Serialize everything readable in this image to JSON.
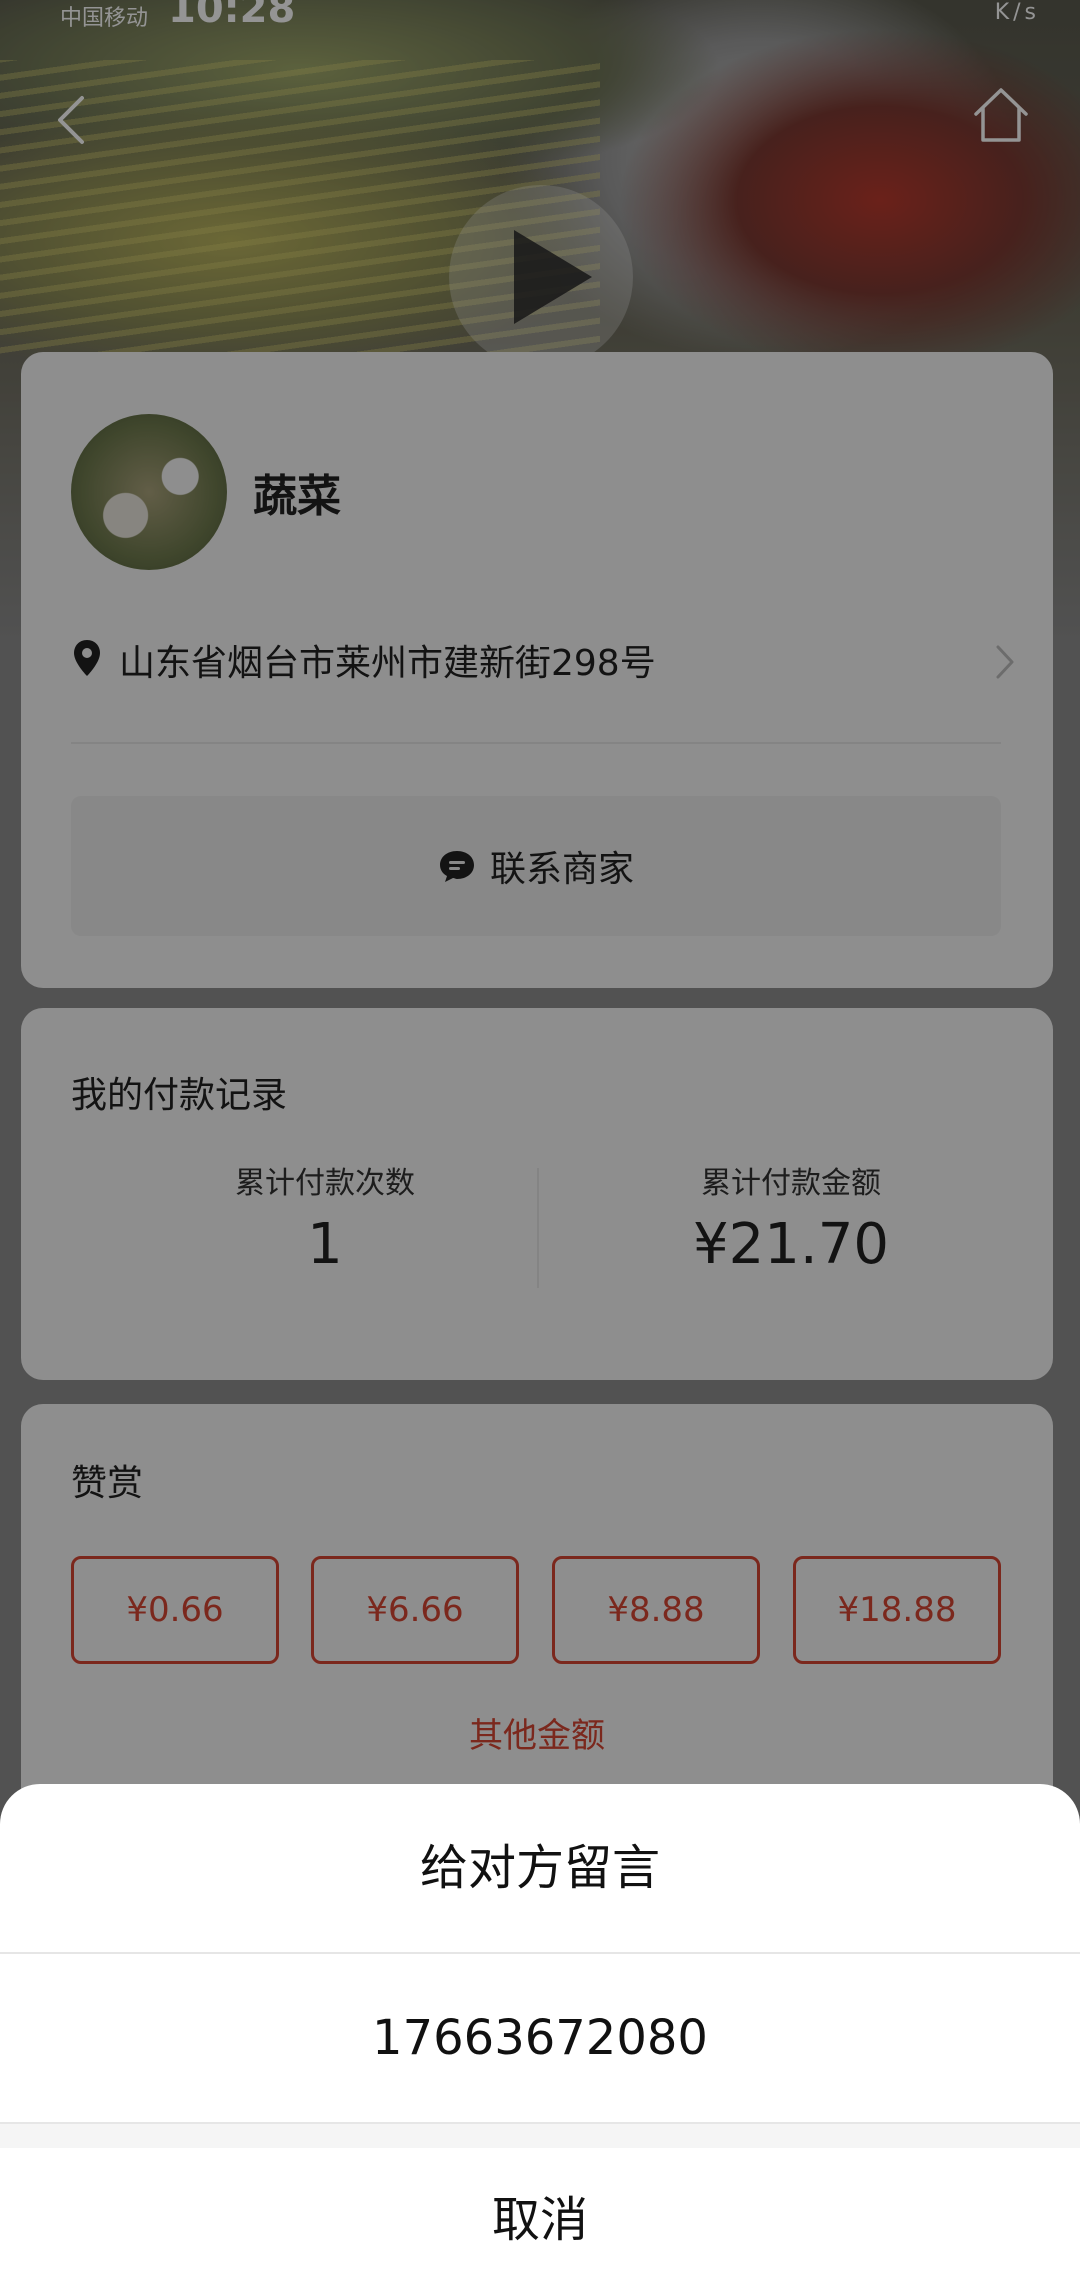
{
  "status_bar": {
    "carrier": "中国移动",
    "time": "10:28",
    "right_indicators": "K/s"
  },
  "header": {
    "back_icon": "chevron-left-icon",
    "home_icon": "home-icon",
    "play_icon": "play-icon"
  },
  "merchant": {
    "name": "蔬菜",
    "address": "山东省烟台市莱州市建新街298号",
    "contact_label": "联系商家"
  },
  "payments": {
    "title": "我的付款记录",
    "count_label": "累计付款次数",
    "count_value": "1",
    "amount_label": "累计付款金额",
    "amount_value": "¥21.70"
  },
  "tip": {
    "title": "赞赏",
    "amounts": [
      "¥0.66",
      "¥6.66",
      "¥8.88",
      "¥18.88"
    ],
    "other_label": "其他金额",
    "accent_color": "#d54533"
  },
  "action_sheet": {
    "message_label": "给对方留言",
    "phone_label": "17663672080",
    "cancel_label": "取消"
  }
}
